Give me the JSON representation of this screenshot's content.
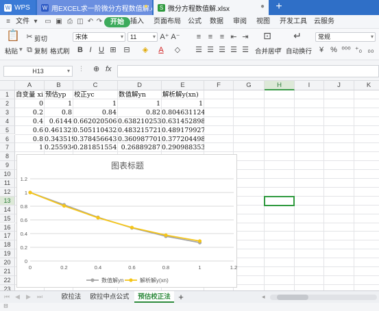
{
  "tabs": {
    "home": "WPS",
    "doc": "用EXCEL求一阶微分方程数值解.docx",
    "xls": "微分方程数值解.xlsx",
    "new_tab": "+"
  },
  "menu": {
    "file": "文件",
    "start": "开始",
    "insert": "插入",
    "page_layout": "页面布局",
    "formula": "公式",
    "data": "数据",
    "review": "审阅",
    "view": "视图",
    "dev_tools": "开发工具",
    "cloud": "云服务"
  },
  "ribbon": {
    "cut": "剪切",
    "paste": "粘贴",
    "copy": "复制",
    "format_painter": "格式刷",
    "font_name": "宋体",
    "font_size": "11",
    "merge_center": "合并居中",
    "wrap_text": "自动换行",
    "number_format": "常规",
    "bold": "B",
    "italic": "I",
    "underline": "U",
    "font_color": "A"
  },
  "formula_bar": {
    "cell_ref": "H13",
    "fx": "fx",
    "value": ""
  },
  "columns": [
    "A",
    "B",
    "C",
    "D",
    "E",
    "F",
    "G",
    "H",
    "I",
    "J",
    "K"
  ],
  "selected_column": "H",
  "selected_row": 13,
  "rows": [
    "1",
    "2",
    "3",
    "4",
    "5",
    "6",
    "7",
    "8",
    "9",
    "10",
    "11",
    "12",
    "13",
    "14",
    "15",
    "16",
    "17",
    "18",
    "19",
    "20",
    "21",
    "22",
    "23"
  ],
  "sheet": {
    "headers": [
      "自变量 xi",
      "预估yp",
      "校正yc",
      "数值解yn",
      "解析解y(xn)"
    ],
    "data": [
      [
        "0",
        "1",
        "1",
        "1",
        "1"
      ],
      [
        "0.2",
        "0.8",
        "0.84",
        "0.82",
        "0.804631124"
      ],
      [
        "0.4",
        "0.6144",
        "0.662020506",
        "0.638210253",
        "0.631452898"
      ],
      [
        "0.6",
        "0.461321",
        "0.505110432",
        "0.483215721",
        "0.489179927"
      ],
      [
        "0.8",
        "0.343519",
        "0.378456643",
        "0.360987701",
        "0.377204498"
      ],
      [
        "1",
        "0.255934",
        "0.281851554",
        "0.26889287",
        "0.290988353"
      ]
    ]
  },
  "chart_data": {
    "type": "line",
    "title": "图表标题",
    "x": [
      0,
      0.2,
      0.4,
      0.6,
      0.8,
      1
    ],
    "xticks": [
      "0",
      "0.2",
      "0.4",
      "0.6",
      "0.8",
      "1",
      "1.2"
    ],
    "yticks": [
      "0",
      "0.2",
      "0.4",
      "0.6",
      "0.8",
      "1",
      "1.2"
    ],
    "xlim": [
      0,
      1.2
    ],
    "ylim": [
      0,
      1.2
    ],
    "grid": true,
    "legend_position": "bottom",
    "series": [
      {
        "name": "数值解yn",
        "color": "#a5a5a5",
        "values": [
          1,
          0.82,
          0.638210253,
          0.483215721,
          0.360987701,
          0.26889287
        ]
      },
      {
        "name": "解析解y(xn)",
        "color": "#f5c518",
        "values": [
          1,
          0.804631124,
          0.631452898,
          0.489179927,
          0.377204498,
          0.290988353
        ]
      }
    ]
  },
  "sheet_tabs": [
    "欧拉法",
    "欧拉中点公式",
    "预估校正法"
  ],
  "active_sheet": "预估校正法",
  "add_sheet": "+"
}
